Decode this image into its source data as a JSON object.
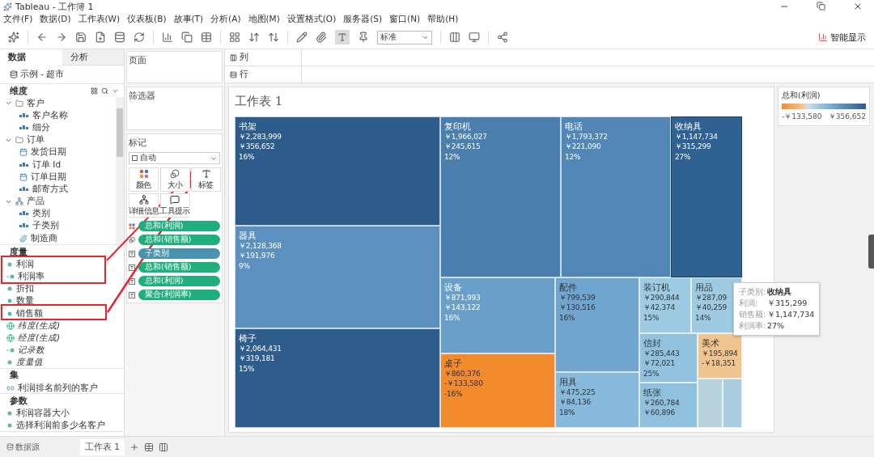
{
  "window": {
    "title": "Tableau - 工作簿 1"
  },
  "menu": [
    "文件(F)",
    "数据(D)",
    "工作表(W)",
    "仪表板(B)",
    "故事(T)",
    "分析(A)",
    "地图(M)",
    "设置格式(O)",
    "服务器(S)",
    "窗口(N)",
    "帮助(H)"
  ],
  "toolbar": {
    "fit_select": "标准",
    "labels_on": true,
    "show_me": "智能显示"
  },
  "side_tabs": [
    {
      "label": "数据",
      "selected": true
    },
    {
      "label": "分析",
      "selected": false
    }
  ],
  "data_source": "示例 - 超市",
  "dimensions": {
    "title": "维度",
    "items": [
      {
        "label": "客户",
        "kind": "folder",
        "expanded": true,
        "children": [
          {
            "label": "客户名称",
            "kind": "text"
          },
          {
            "label": "细分",
            "kind": "text"
          }
        ]
      },
      {
        "label": "订单",
        "kind": "folder",
        "expanded": true,
        "children": [
          {
            "label": "发货日期",
            "kind": "date"
          },
          {
            "label": "订单 Id",
            "kind": "text"
          },
          {
            "label": "订单日期",
            "kind": "date"
          },
          {
            "label": "邮寄方式",
            "kind": "text"
          }
        ]
      },
      {
        "label": "产品",
        "kind": "hierarchy",
        "expanded": true,
        "children": [
          {
            "label": "类别",
            "kind": "text"
          },
          {
            "label": "子类别",
            "kind": "text"
          },
          {
            "label": "制造商",
            "kind": "group"
          }
        ]
      }
    ]
  },
  "measures": {
    "title": "度量",
    "items": [
      {
        "label": "利润",
        "kind": "measure",
        "generated": false
      },
      {
        "label": "利润率",
        "kind": "calc",
        "generated": false
      },
      {
        "label": "折扣",
        "kind": "measure",
        "generated": false
      },
      {
        "label": "数量",
        "kind": "measure",
        "generated": false
      },
      {
        "label": "销售额",
        "kind": "measure",
        "generated": false
      },
      {
        "label": "纬度(生成)",
        "kind": "geo",
        "generated": true
      },
      {
        "label": "经度(生成)",
        "kind": "geo",
        "generated": true
      },
      {
        "label": "记录数",
        "kind": "calc",
        "generated": true
      },
      {
        "label": "度量值",
        "kind": "measure",
        "generated": true
      }
    ]
  },
  "sets": {
    "title": "集",
    "items": [
      {
        "label": "利润排名前列的客户",
        "kind": "set"
      }
    ]
  },
  "parameters": {
    "title": "参数",
    "items": [
      {
        "label": "利润容器大小",
        "kind": "param"
      },
      {
        "label": "选择利润前多少名客户",
        "kind": "param"
      }
    ]
  },
  "shelves": {
    "pages": "页面",
    "filters": "筛选器",
    "columns": "列",
    "rows": "行"
  },
  "marks": {
    "title": "标记",
    "mark_type": "自动",
    "buttons": [
      {
        "label": "颜色",
        "kind": "color"
      },
      {
        "label": "大小",
        "kind": "size"
      },
      {
        "label": "标签",
        "kind": "label"
      },
      {
        "label": "详细信息",
        "kind": "detail"
      },
      {
        "label": "工具提示",
        "kind": "tooltip"
      }
    ],
    "pills": [
      {
        "label": "总和(利润)",
        "kind": "color",
        "color": "#1fae7d"
      },
      {
        "label": "总和(销售额)",
        "kind": "size",
        "color": "#1fae7d"
      },
      {
        "label": "子类别",
        "kind": "label",
        "color": "#4a93b0"
      },
      {
        "label": "总和(销售额)",
        "kind": "label",
        "color": "#1fae7d"
      },
      {
        "label": "总和(利润)",
        "kind": "label",
        "color": "#1fae7d"
      },
      {
        "label": "聚合(利润率)",
        "kind": "label",
        "color": "#1fae7d"
      }
    ]
  },
  "sheet": {
    "title": "工作表 1",
    "treemap": [
      {
        "label": "书架",
        "lines": [
          "￥2,283,999",
          "￥356,652",
          "16%"
        ],
        "color": "#2d5b8a"
      },
      {
        "label": "器具",
        "lines": [
          "￥2,128,368",
          "￥191,976",
          "9%"
        ],
        "color": "#5b90bf"
      },
      {
        "label": "椅子",
        "lines": [
          "￥2,064,431",
          "￥319,181",
          "15%"
        ],
        "color": "#2e5d8c"
      },
      {
        "label": "复印机",
        "lines": [
          "￥1,966,027",
          "￥245,615",
          "12%"
        ],
        "color": "#4a7fad"
      },
      {
        "label": "电话",
        "lines": [
          "￥1,793,372",
          "￥221,090",
          "12%"
        ],
        "color": "#5186b6"
      },
      {
        "label": "收纳具",
        "lines": [
          "￥1,147,734",
          "￥315,299",
          "27%"
        ],
        "color": "#2f6193"
      },
      {
        "label": "设备",
        "lines": [
          "￥871,993",
          "￥143,122",
          "16%"
        ],
        "color": "#6a9fca"
      },
      {
        "label": "桌子",
        "lines": [
          "￥860,376",
          "-￥133,580",
          "-16%"
        ],
        "color": "#f28a2e"
      },
      {
        "label": "配件",
        "lines": [
          "￥799,539",
          "￥130,516",
          "16%"
        ],
        "color": "#6fa5cf"
      },
      {
        "label": "用具",
        "lines": [
          "￥475,225",
          "￥84,136",
          "18%"
        ],
        "color": "#86b9db"
      },
      {
        "label": "装订机",
        "lines": [
          "￥290,844",
          "￥42,374",
          "15%"
        ],
        "color": "#9ccbe3"
      },
      {
        "label": "用品",
        "lines": [
          "￥287,09",
          "￥40,259",
          "14%"
        ],
        "color": "#9ecbe2"
      },
      {
        "label": "信封",
        "lines": [
          "￥285,443",
          "￥72,021",
          "25%"
        ],
        "color": "#91c3e0"
      },
      {
        "label": "纸张",
        "lines": [
          "￥260,784",
          "￥60,896"
        ],
        "color": "#8fc0de"
      },
      {
        "label": "美术",
        "lines": [
          "￥195,894",
          "-￥18,351"
        ],
        "color": "#f0c48f"
      },
      {
        "color": "#b8d2dc"
      },
      {
        "color": "#a9cde0"
      }
    ],
    "tooltip": [
      {
        "label": "子类别:",
        "value": "收纳具"
      },
      {
        "label": "利润:",
        "value": "￥315,299"
      },
      {
        "label": "销售额:",
        "value": "￥1,147,734"
      },
      {
        "label": "利润率:",
        "value": "27%"
      }
    ]
  },
  "legend": {
    "title": "总和(利润)",
    "min": "-￥133,580",
    "max": "￥356,652"
  },
  "bottom": {
    "data_source": "数据源",
    "tabs": [
      {
        "label": "工作表 1",
        "selected": true
      }
    ]
  }
}
